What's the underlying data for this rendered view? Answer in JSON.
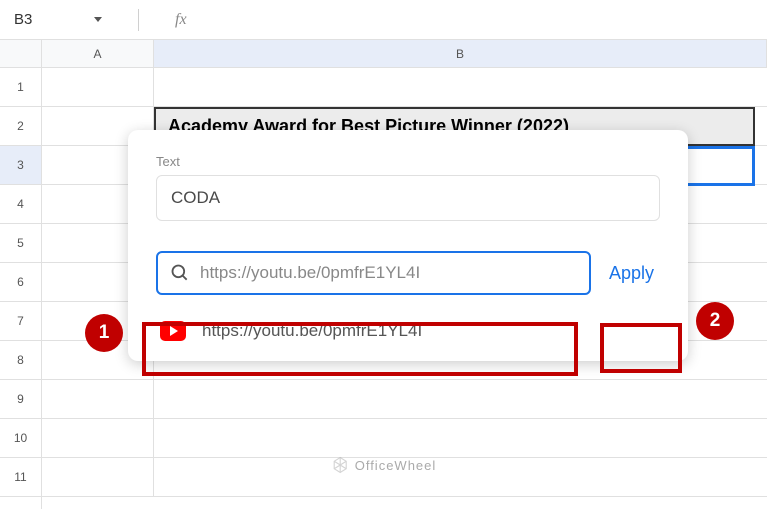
{
  "nameBox": "B3",
  "columns": {
    "A": "A",
    "B": "B"
  },
  "rows": [
    "1",
    "2",
    "3",
    "4",
    "5",
    "6",
    "7",
    "8",
    "9",
    "10",
    "11"
  ],
  "headerCell": "Academy Award for Best Picture Winner (2022)",
  "popup": {
    "textLabel": "Text",
    "textValue": "CODA",
    "linkPlaceholder": "https://youtu.be/0pmfrE1YL4I",
    "applyLabel": "Apply",
    "suggestion": "https://youtu.be/0pmfrE1YL4I"
  },
  "callouts": {
    "one": "1",
    "two": "2"
  },
  "watermark": "OfficeWheel"
}
